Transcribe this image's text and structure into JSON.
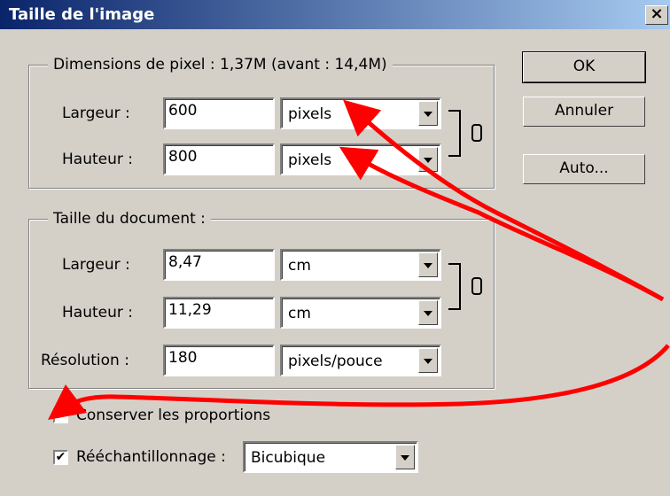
{
  "window": {
    "title": "Taille de l'image",
    "close_glyph": "×"
  },
  "pixel_dimensions": {
    "legend": "Dimensions de pixel : 1,37M (avant : 14,4M)",
    "width_label": "Largeur :",
    "width_value": "600",
    "width_unit": "pixels",
    "height_label": "Hauteur :",
    "height_value": "800",
    "height_unit": "pixels"
  },
  "document_size": {
    "legend": "Taille du document :",
    "width_label": "Largeur :",
    "width_value": "8,47",
    "width_unit": "cm",
    "height_label": "Hauteur :",
    "height_value": "11,29",
    "height_unit": "cm",
    "resolution_label": "Résolution :",
    "resolution_value": "180",
    "resolution_unit": "pixels/pouce"
  },
  "buttons": {
    "ok": "OK",
    "cancel": "Annuler",
    "auto": "Auto..."
  },
  "options": {
    "constrain_label": "Conserver les proportions",
    "constrain_checked": "✔",
    "resample_label": "Rééchantillonnage :",
    "resample_checked": "✔",
    "resample_method": "Bicubique"
  },
  "annotation_color": "#ff0000"
}
